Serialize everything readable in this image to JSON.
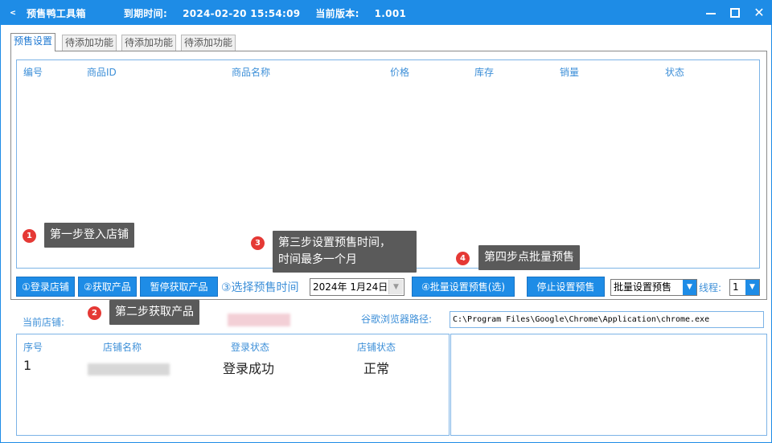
{
  "window": {
    "icon_text": "ᯝ",
    "title": "预售鸭工具箱",
    "expiry_label": "到期时间:",
    "expiry_value": "2024-02-20 15:54:09",
    "version_label": "当前版本:",
    "version_value": "1.001",
    "close_glyph": "✕"
  },
  "tabs": [
    {
      "label": "预售设置"
    },
    {
      "label": "待添加功能"
    },
    {
      "label": "待添加功能"
    },
    {
      "label": "待添加功能"
    }
  ],
  "product_table": {
    "columns": [
      "编号",
      "商品ID",
      "商品名称",
      "价格",
      "库存",
      "销量",
      "状态"
    ]
  },
  "tips": [
    {
      "num": "1",
      "text": "第一步登入店铺"
    },
    {
      "num": "2",
      "text": "第二步获取产品"
    },
    {
      "num": "3",
      "line1": "第三步设置预售时间，",
      "line2": "时间最多一个月"
    },
    {
      "num": "4",
      "text": "第四步点批量预售"
    }
  ],
  "toolbar": {
    "login_button": "①登录店铺",
    "fetch_button": "②获取产品",
    "pause_button": "暂停获取产品",
    "step3_label": "③选择预售时间",
    "date_value": "2024年  1月24日",
    "date_dropdown": "▼",
    "batch_button": "④批量设置预售(选)",
    "stop_button": "停止设置预售",
    "mode_select": "批量设置预售",
    "thread_label": "线程:",
    "thread_select": "1"
  },
  "shop": {
    "current_shop_label": "当前店铺:",
    "browser_path_label": "谷歌浏览器路径:",
    "browser_path_value": "C:\\Program Files\\Google\\Chrome\\Application\\chrome.exe"
  },
  "shop_table": {
    "columns": [
      "序号",
      "店铺名称",
      "登录状态",
      "店铺状态"
    ],
    "rows": [
      {
        "index": "1",
        "login_status": "登录成功",
        "shop_status": "正常"
      }
    ]
  },
  "colors": {
    "accent": "#1e8ce6",
    "header_text": "#3d8fd8",
    "badge": "#e53935",
    "tooltip_bg": "#5a5a5a"
  }
}
